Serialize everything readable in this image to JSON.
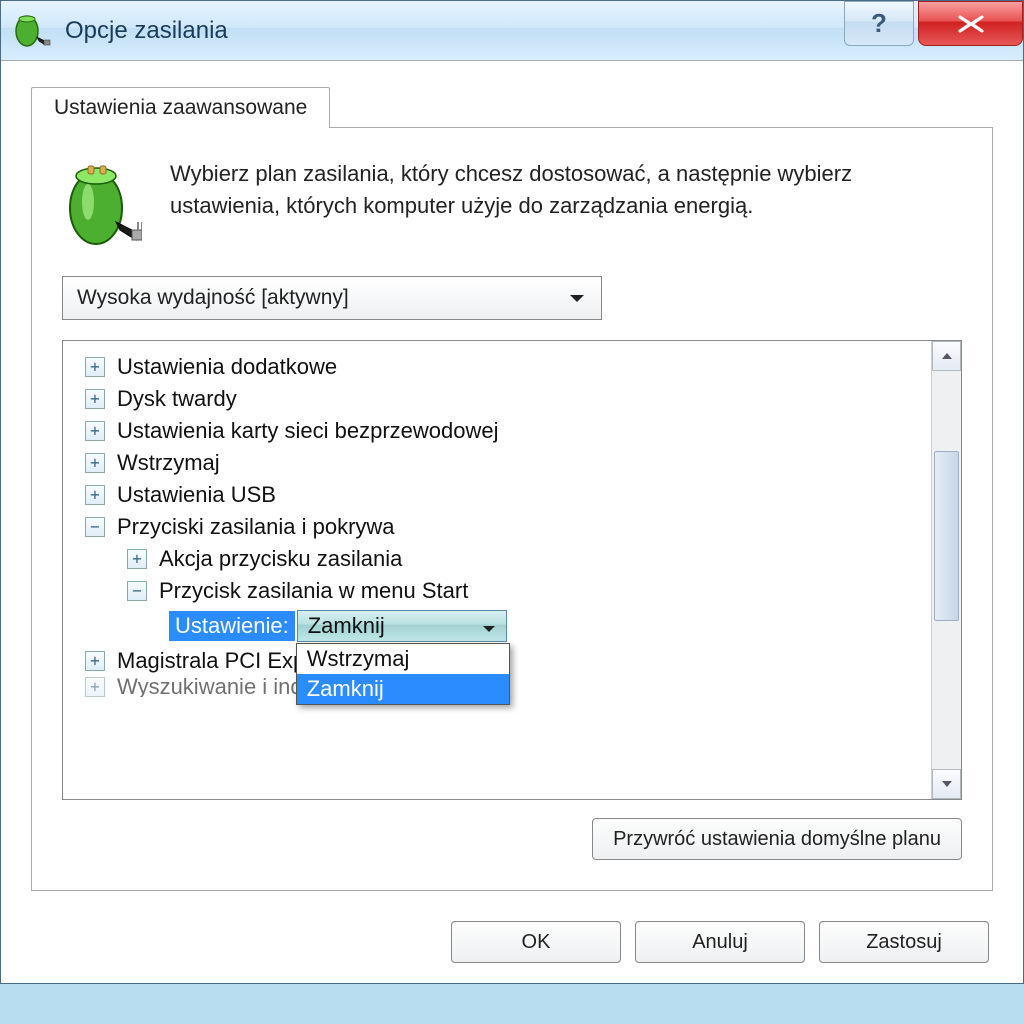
{
  "window": {
    "title": "Opcje zasilania"
  },
  "tab": {
    "label": "Ustawienia zaawansowane"
  },
  "intro": {
    "text": "Wybierz plan zasilania, który chcesz dostosować, a następnie wybierz ustawienia, których komputer użyje do zarządzania energią."
  },
  "plan_select": {
    "value": "Wysoka wydajność [aktywny]"
  },
  "tree": {
    "items": [
      {
        "label": "Ustawienia dodatkowe",
        "level": 1,
        "exp": "+"
      },
      {
        "label": "Dysk twardy",
        "level": 1,
        "exp": "+"
      },
      {
        "label": "Ustawienia karty sieci bezprzewodowej",
        "level": 1,
        "exp": "+"
      },
      {
        "label": "Wstrzymaj",
        "level": 1,
        "exp": "+"
      },
      {
        "label": "Ustawienia USB",
        "level": 1,
        "exp": "+"
      },
      {
        "label": "Przyciski zasilania i pokrywa",
        "level": 1,
        "exp": "−"
      },
      {
        "label": "Akcja przycisku zasilania",
        "level": 2,
        "exp": "+"
      },
      {
        "label": "Przycisk zasilania w menu Start",
        "level": 2,
        "exp": "−"
      },
      {
        "label": "Magistrala PCI Express",
        "level": 1,
        "exp": "+",
        "truncated": false
      },
      {
        "label": "Wyszukiwanie i indeksowanie",
        "level": 1,
        "exp": "+",
        "truncated": true
      }
    ],
    "setting": {
      "label": "Ustawienie:",
      "value": "Zamknij",
      "options": [
        "Wstrzymaj",
        "Zamknij"
      ],
      "selected": "Zamknij"
    }
  },
  "buttons": {
    "restore": "Przywróć ustawienia domyślne planu",
    "ok": "OK",
    "cancel": "Anuluj",
    "apply": "Zastosuj"
  }
}
